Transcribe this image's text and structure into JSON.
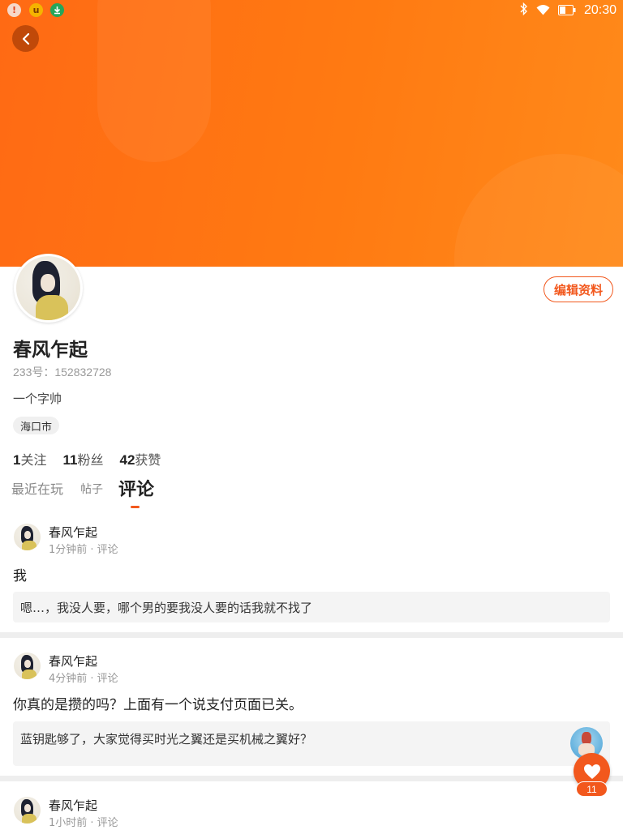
{
  "status_bar": {
    "left_icons": [
      "alert-icon",
      "uc-browser-icon",
      "download-icon"
    ],
    "right_icons": [
      "bluetooth-icon",
      "wifi-icon",
      "battery-icon"
    ],
    "time": "20:30"
  },
  "header": {
    "back_icon": "back-arrow-icon",
    "edit_label": "编辑资料"
  },
  "profile": {
    "name": "春风乍起",
    "id_text": "233号：152832728",
    "bio": "一个字帅",
    "location": "海口市",
    "stats": [
      {
        "num": "1",
        "label": "关注"
      },
      {
        "num": "11",
        "label": "粉丝"
      },
      {
        "num": "42",
        "label": "获赞"
      }
    ]
  },
  "tabs": [
    {
      "label": "最近在玩",
      "active": false
    },
    {
      "label": "帖子",
      "active": false
    },
    {
      "label": "评论",
      "active": true
    }
  ],
  "comments": [
    {
      "user": "春风乍起",
      "meta": "1分钟前 · 评论",
      "text": "我",
      "quote": "嗯…，我没人要，哪个男的要我没人要的话我就不找了"
    },
    {
      "user": "春风乍起",
      "meta": "4分钟前 · 评论",
      "text": "你真的是攒的吗？上面有一个说支付页面已关。",
      "quote": "蓝钥匙够了，大家觉得买时光之翼还是买机械之翼好？"
    },
    {
      "user": "春风乍起",
      "meta": "1小时前 · 评论"
    }
  ],
  "float": {
    "like_count": "11"
  },
  "colors": {
    "accent": "#f2581d",
    "banner_start": "#ff6a14",
    "banner_end": "#ff8a1a"
  }
}
